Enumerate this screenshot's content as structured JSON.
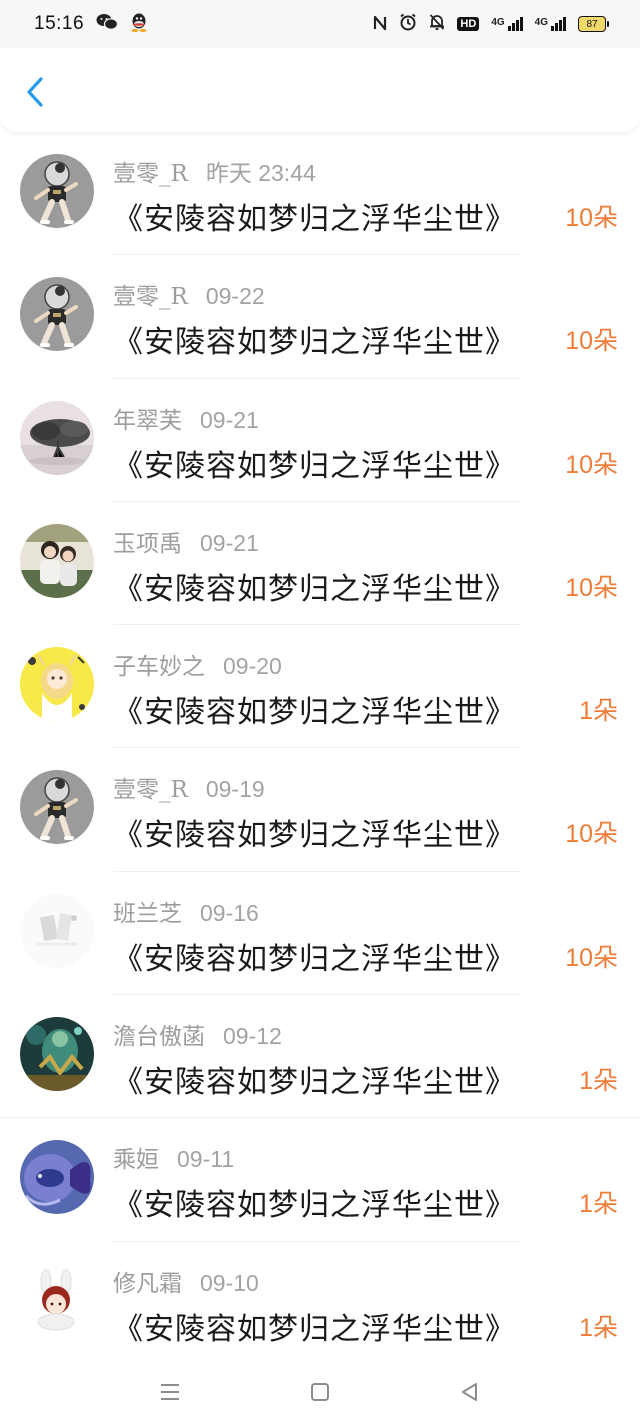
{
  "status_bar": {
    "time": "15:16",
    "left_icons": [
      "wechat-icon",
      "qq-icon"
    ],
    "right_icons": [
      "nfc-icon",
      "alarm-icon",
      "mute-icon",
      "hd-icon",
      "signal-4g-icon",
      "signal-4g-icon-2",
      "battery-icon"
    ],
    "hd_label": "HD",
    "net1_label": "4G",
    "net2_label": "4G",
    "battery_level": "87"
  },
  "nav": {
    "back_icon": "chevron-left-icon",
    "accent_color": "#2b9ae8"
  },
  "list": {
    "rows": [
      {
        "user": "壹零_R",
        "time": "昨天 23:44",
        "title": "《安陵容如梦归之浮华尘世》",
        "count": "10朵",
        "avatar": "avatar-basketball-boy"
      },
      {
        "user": "壹零_R",
        "time": "09-22",
        "title": "《安陵容如梦归之浮华尘世》",
        "count": "10朵",
        "avatar": "avatar-basketball-boy"
      },
      {
        "user": "年翠芙",
        "time": "09-21",
        "title": "《安陵容如梦归之浮华尘世》",
        "count": "10朵",
        "avatar": "avatar-misty-tree"
      },
      {
        "user": "玉项禹",
        "time": "09-21",
        "title": "《安陵容如梦归之浮华尘世》",
        "count": "10朵",
        "avatar": "avatar-two-girls"
      },
      {
        "user": "子车妙之",
        "time": "09-20",
        "title": "《安陵容如梦归之浮华尘世》",
        "count": "1朵",
        "avatar": "avatar-yellow-anime-girl"
      },
      {
        "user": "壹零_R",
        "time": "09-19",
        "title": "《安陵容如梦归之浮华尘世》",
        "count": "10朵",
        "avatar": "avatar-basketball-boy"
      },
      {
        "user": "班兰芝",
        "time": "09-16",
        "title": "《安陵容如梦归之浮华尘世》",
        "count": "10朵",
        "avatar": "avatar-pale-sketch"
      },
      {
        "user": "澹台傲菡",
        "time": "09-12",
        "title": "《安陵容如梦归之浮华尘世》",
        "count": "1朵",
        "avatar": "avatar-green-warrior"
      },
      {
        "user": "乘姮",
        "time": "09-11",
        "title": "《安陵容如梦归之浮华尘世》",
        "count": "1朵",
        "avatar": "avatar-blue-fish"
      },
      {
        "user": "修凡霜",
        "time": "09-10",
        "title": "《安陵容如梦归之浮华尘世》",
        "count": "1朵",
        "avatar": "avatar-chibi-bunny"
      }
    ]
  },
  "colors": {
    "count": "#ef7d3a",
    "meta": "#9d9d9d",
    "title": "#1a1a1a"
  },
  "system_nav": {
    "icons": [
      "menu-icon",
      "home-square-icon",
      "back-triangle-icon"
    ]
  }
}
